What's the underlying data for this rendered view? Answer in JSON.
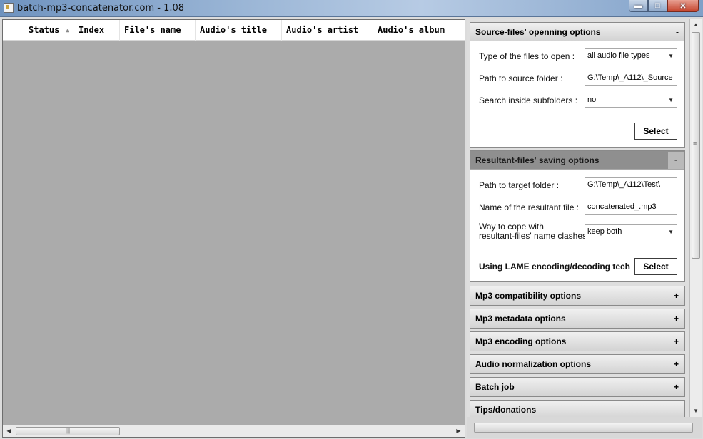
{
  "window": {
    "title": "batch-mp3-concatenator.com - 1.08",
    "controls": {
      "minimize": "▬",
      "maximize": "□",
      "close": "✕"
    }
  },
  "list": {
    "columns": [
      "",
      "Status",
      "Index",
      "File's name",
      "Audio's title",
      "Audio's artist",
      "Audio's album"
    ],
    "sort_indicator": "▲",
    "rows": []
  },
  "panel": {
    "source": {
      "header": "Source-files' openning options",
      "toggle": "-",
      "type_label": "Type of the files to open :",
      "type_value": "all audio file types",
      "path_label": "Path to source folder :",
      "path_value": "G:\\Temp\\_A112\\_Source",
      "subfolders_label": "Search inside subfolders :",
      "subfolders_value": "no",
      "select_button": "Select"
    },
    "target": {
      "header": "Resultant-files' saving options",
      "toggle": "-",
      "path_label": "Path to target folder :",
      "path_value": "G:\\Temp\\_A112\\Test\\",
      "name_label": "Name of the resultant file :",
      "name_value": "concatenated_.mp3",
      "clash_label_1": "Way to cope with",
      "clash_label_2": "resultant-files' name clashes",
      "clash_value": "keep both",
      "lame_label": "Using LAME encoding/decoding tech",
      "select_button": "Select"
    },
    "collapsed_sections": [
      {
        "label": "Mp3 compatibility options",
        "toggle": "+"
      },
      {
        "label": "Mp3 metadata options",
        "toggle": "+"
      },
      {
        "label": "Mp3 encoding options",
        "toggle": "+"
      },
      {
        "label": "Audio normalization options",
        "toggle": "+"
      },
      {
        "label": "Batch job",
        "toggle": "+"
      },
      {
        "label": "Tips/donations",
        "toggle": ""
      }
    ]
  },
  "progress": {
    "value": 0
  }
}
